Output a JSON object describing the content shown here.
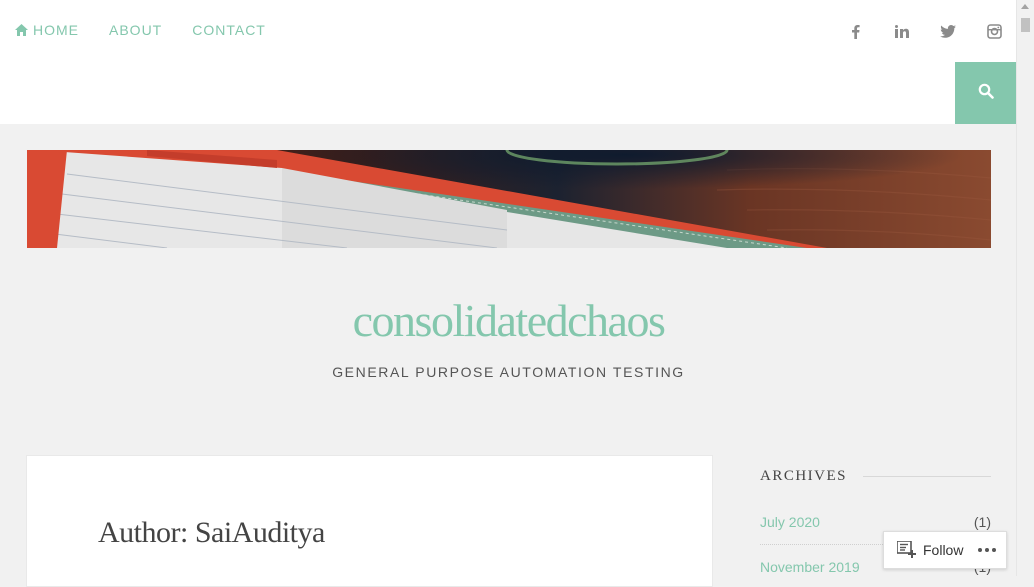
{
  "nav": {
    "items": [
      {
        "label": "HOME",
        "icon": "home-icon"
      },
      {
        "label": "ABOUT"
      },
      {
        "label": "CONTACT"
      }
    ]
  },
  "social": [
    "facebook-icon",
    "linkedin-icon",
    "twitter-icon",
    "instagram-icon"
  ],
  "search": {
    "icon": "search-icon"
  },
  "site": {
    "title": "consolidatedchaos",
    "tagline": "GENERAL PURPOSE AUTOMATION TESTING"
  },
  "main": {
    "heading": "Author: SaiAuditya"
  },
  "sidebar": {
    "archives_title": "ARCHIVES",
    "items": [
      {
        "label": "July 2020",
        "count": "(1)"
      },
      {
        "label": "November 2019",
        "count": "(1)"
      }
    ]
  },
  "follow": {
    "label": "Follow"
  },
  "colors": {
    "accent": "#84c7ad",
    "background": "#f1f1f1"
  }
}
